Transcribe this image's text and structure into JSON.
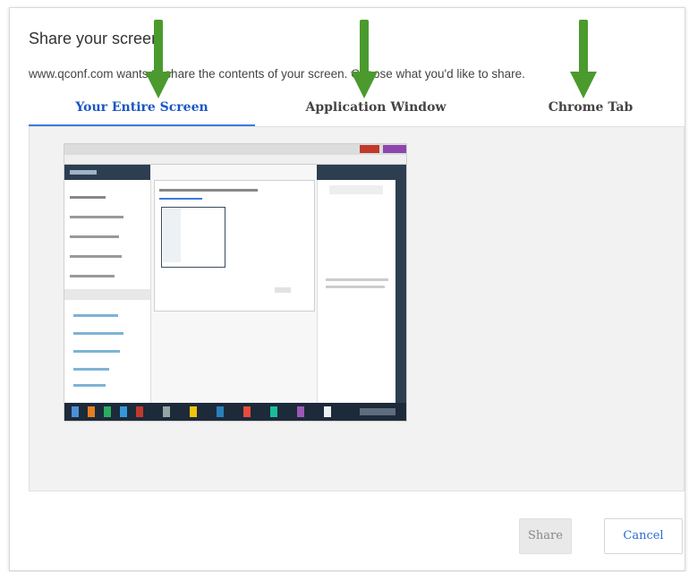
{
  "dialog": {
    "title": "Share your screen",
    "subtitle": "www.qconf.com wants to share the contents of your screen. Choose what you'd like to share.",
    "tabs": [
      {
        "label": "Your Entire Screen",
        "selected": true
      },
      {
        "label": "Application Window",
        "selected": false
      },
      {
        "label": "Chrome Tab",
        "selected": false
      }
    ],
    "share_label": "Share",
    "cancel_label": "Cancel"
  },
  "colors": {
    "accent": "#3b7be0",
    "arrow": "#4a9a2e",
    "sidebar_dark": "#2c3e50",
    "taskbar": "#1d2a3a"
  },
  "icons": {
    "annotation_arrow": "arrow-down-icon"
  }
}
